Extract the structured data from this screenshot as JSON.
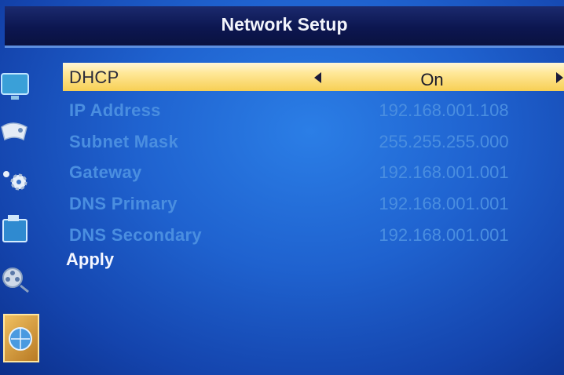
{
  "header": {
    "title": "Network Setup"
  },
  "sidebar": {
    "icons": [
      "tv-icon",
      "game-controller-icon",
      "gear-settings-icon",
      "media-icon",
      "film-reel-icon",
      "globe-network-icon"
    ]
  },
  "settings": {
    "dhcp": {
      "label": "DHCP",
      "value": "On"
    },
    "ip_address": {
      "label": "IP Address",
      "value": "192.168.001.108"
    },
    "subnet_mask": {
      "label": "Subnet Mask",
      "value": "255.255.255.000"
    },
    "gateway": {
      "label": "Gateway",
      "value": "192.168.001.001"
    },
    "dns_primary": {
      "label": "DNS Primary",
      "value": "192.168.001.001"
    },
    "dns_secondary": {
      "label": "DNS Secondary",
      "value": "192.168.001.001"
    }
  },
  "apply_label": "Apply",
  "colors": {
    "selected_row": "#f7cf54",
    "disabled_text": "#4a8ee0",
    "active_text": "#f4f6ff",
    "header_bg": "#0c1650"
  }
}
